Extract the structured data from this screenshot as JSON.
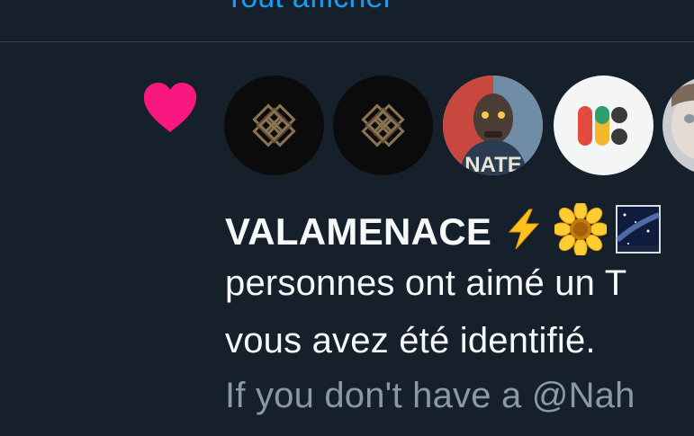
{
  "notification": {
    "top_link": "Tout afficher",
    "user_name": "VALAMENACE",
    "message_line1": "personnes ont aimé un T",
    "message_line2": "vous avez été identifié.",
    "quoted_text": "If you don't have a @Nah",
    "avatars": [
      {
        "icon": "geometric-logo-avatar"
      },
      {
        "icon": "geometric-logo-avatar"
      },
      {
        "icon": "person-photo-avatar",
        "label": "NATE"
      },
      {
        "icon": "colored-blocks-logo-avatar"
      },
      {
        "icon": "blurred-photo-avatar"
      }
    ],
    "emojis": [
      "lightning-icon",
      "sunflower-icon",
      "night-sky-icon"
    ]
  },
  "colors": {
    "background": "#15202b",
    "divider": "#38444d",
    "link": "#1d9bf0",
    "heart": "#f91880",
    "text_primary": "#f7f9f9",
    "text_secondary": "#8b98a5"
  }
}
